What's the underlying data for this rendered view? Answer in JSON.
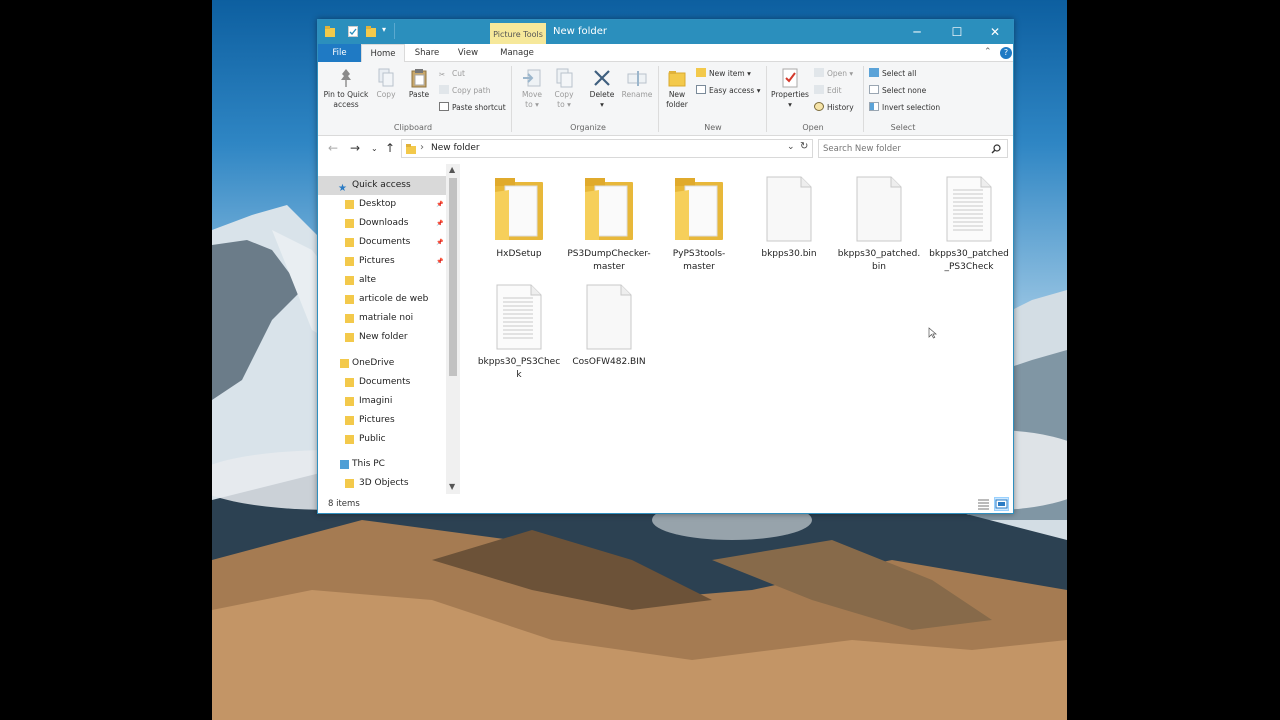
{
  "window": {
    "title": "New folder",
    "context_tab": "Picture Tools",
    "controls": {
      "minimize": "─",
      "maximize": "☐",
      "close": "✕"
    }
  },
  "tabs": {
    "file": "File",
    "home": "Home",
    "share": "Share",
    "view": "View",
    "manage": "Manage"
  },
  "ribbon": {
    "clipboard": {
      "group": "Clipboard",
      "pin_line1": "Pin to Quick",
      "pin_line2": "access",
      "copy": "Copy",
      "paste": "Paste",
      "cut": "Cut",
      "copy_path": "Copy path",
      "paste_shortcut": "Paste shortcut"
    },
    "organize": {
      "group": "Organize",
      "move_line1": "Move",
      "move_line2": "to ▾",
      "copy_line1": "Copy",
      "copy_line2": "to ▾",
      "delete_line1": "Delete",
      "delete_line2": "▾",
      "rename": "Rename"
    },
    "new": {
      "group": "New",
      "new_folder_line1": "New",
      "new_folder_line2": "folder",
      "new_item": "New item ▾",
      "easy_access": "Easy access ▾"
    },
    "open": {
      "group": "Open",
      "properties_line1": "Properties",
      "properties_line2": "▾",
      "open": "Open ▾",
      "edit": "Edit",
      "history": "History"
    },
    "select": {
      "group": "Select",
      "select_all": "Select all",
      "select_none": "Select none",
      "invert_selection": "Invert selection"
    }
  },
  "address": {
    "path": "New folder",
    "separator": "›",
    "search_placeholder": "Search New folder"
  },
  "nav": {
    "quick_access": "Quick access",
    "quick_items": [
      {
        "label": "Desktop",
        "pinned": true
      },
      {
        "label": "Downloads",
        "pinned": true
      },
      {
        "label": "Documents",
        "pinned": true
      },
      {
        "label": "Pictures",
        "pinned": true
      },
      {
        "label": "alte",
        "pinned": false
      },
      {
        "label": "articole de web",
        "pinned": false
      },
      {
        "label": "matriale noi",
        "pinned": false
      },
      {
        "label": "New folder",
        "pinned": false
      }
    ],
    "onedrive": "OneDrive",
    "onedrive_items": [
      "Documents",
      "Imagini",
      "Pictures",
      "Public"
    ],
    "this_pc": "This PC",
    "this_pc_items": [
      "3D Objects"
    ]
  },
  "files": [
    {
      "name": "HxDSetup",
      "type": "folder"
    },
    {
      "name": "PS3DumpChecker-master",
      "type": "folder"
    },
    {
      "name": "PyPS3tools-master",
      "type": "folder"
    },
    {
      "name": "bkpps30.bin",
      "type": "file"
    },
    {
      "name": "bkpps30_patched.bin",
      "type": "file"
    },
    {
      "name": "bkpps30_patched_PS3Check",
      "type": "textfile"
    },
    {
      "name": "bkpps30_PS3Check",
      "type": "textfile"
    },
    {
      "name": "CosOFW482.BIN",
      "type": "file"
    }
  ],
  "status": {
    "item_count": "8 items"
  },
  "colors": {
    "titlebar": "#2b8fbd",
    "file_tab": "#1f7ac4",
    "folder": "#f3c94b",
    "selection": "#cce8ff"
  }
}
